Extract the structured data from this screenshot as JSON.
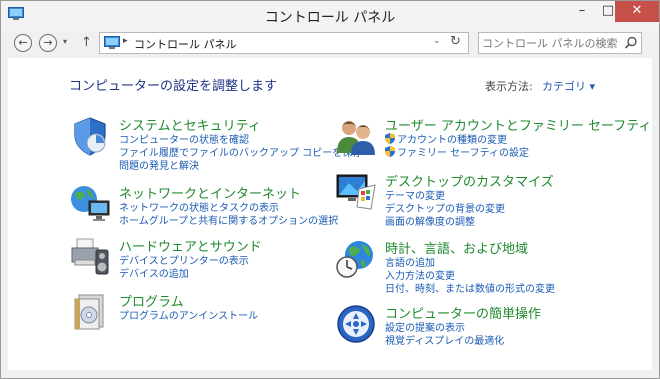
{
  "window": {
    "title": "コントロール パネル",
    "buttons": {
      "minimize": "–",
      "maximize": "□",
      "close": "✕"
    }
  },
  "nav": {
    "back_glyph": "←",
    "forward_glyph": "→",
    "recent_glyph": "▾",
    "up_glyph": "↑",
    "address_separator": "▸",
    "address": "コントロール パネル",
    "address_dropdown_glyph": "⌄",
    "refresh_glyph": "↻",
    "search_placeholder": "コントロール パネルの検索"
  },
  "main": {
    "heading": "コンピューターの設定を調整します",
    "view_by_label": "表示方法:",
    "view_by_value": "カテゴリ ▾"
  },
  "categories": [
    {
      "icon": "system-security-icon",
      "title": "システムとセキュリティ",
      "links": [
        {
          "label": "コンピューターの状態を確認"
        },
        {
          "label": "ファイル履歴でファイルのバックアップ コピーを保存"
        },
        {
          "label": "問題の発見と解決"
        }
      ]
    },
    {
      "icon": "network-internet-icon",
      "title": "ネットワークとインターネット",
      "links": [
        {
          "label": "ネットワークの状態とタスクの表示"
        },
        {
          "label": "ホームグループと共有に関するオプションの選択"
        }
      ]
    },
    {
      "icon": "hardware-sound-icon",
      "title": "ハードウェアとサウンド",
      "links": [
        {
          "label": "デバイスとプリンターの表示"
        },
        {
          "label": "デバイスの追加"
        }
      ]
    },
    {
      "icon": "programs-icon",
      "title": "プログラム",
      "links": [
        {
          "label": "プログラムのアンインストール"
        }
      ]
    },
    {
      "icon": "user-accounts-icon",
      "title": "ユーザー アカウントとファミリー セーフティ",
      "links": [
        {
          "label": "アカウントの種類の変更",
          "shield": true
        },
        {
          "label": "ファミリー セーフティの設定",
          "shield": true
        }
      ]
    },
    {
      "icon": "appearance-personalization-icon",
      "title": "デスクトップのカスタマイズ",
      "links": [
        {
          "label": "テーマの変更"
        },
        {
          "label": "デスクトップの背景の変更"
        },
        {
          "label": "画面の解像度の調整"
        }
      ]
    },
    {
      "icon": "clock-language-region-icon",
      "title": "時計、言語、および地域",
      "links": [
        {
          "label": "言語の追加"
        },
        {
          "label": "入力方法の変更"
        },
        {
          "label": "日付、時刻、または数値の形式の変更"
        }
      ]
    },
    {
      "icon": "ease-of-access-icon",
      "title": "コンピューターの簡単操作",
      "links": [
        {
          "label": "設定の提案の表示"
        },
        {
          "label": "視覚ディスプレイの最適化"
        }
      ]
    }
  ]
}
